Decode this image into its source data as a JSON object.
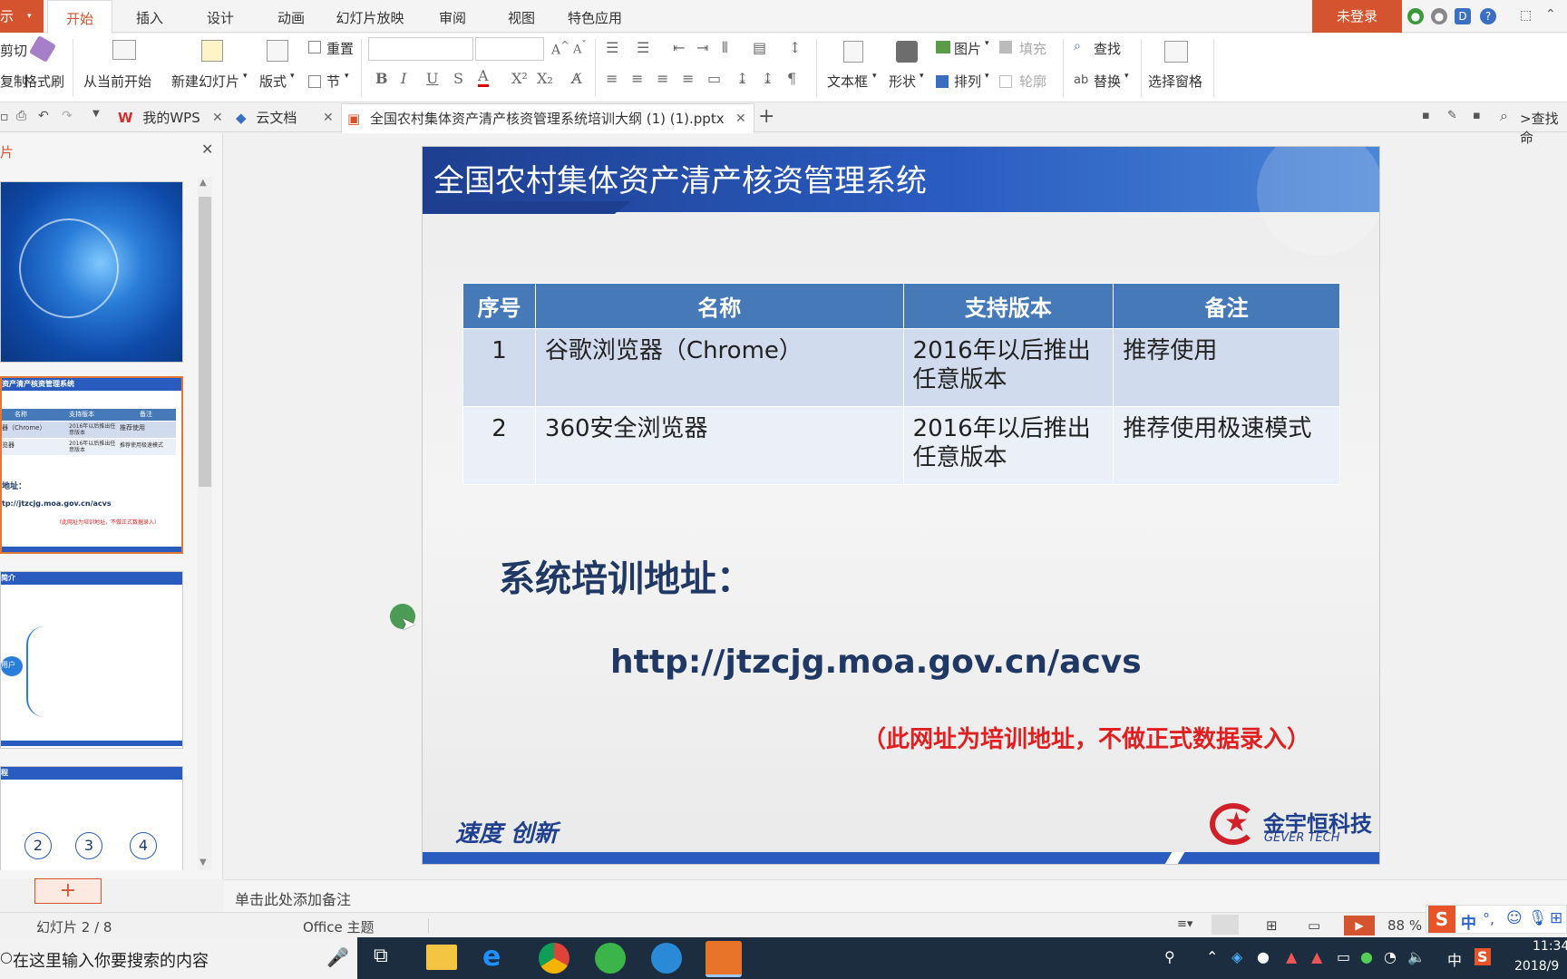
{
  "app": {
    "label": "示",
    "login": "未登录"
  },
  "menu": [
    "开始",
    "插入",
    "设计",
    "动画",
    "幻灯片放映",
    "审阅",
    "视图",
    "特色应用"
  ],
  "ribbon": {
    "cut": "剪切",
    "copy": "复制",
    "format_painter": "格式刷",
    "from_current": "从当前开始",
    "new_slide": "新建幻灯片",
    "layout": "版式",
    "reset": "重置",
    "section": "节",
    "textbox": "文本框",
    "shape": "形状",
    "picture": "图片",
    "fill": "填充",
    "arrange": "排列",
    "outline": "轮廓",
    "find": "查找",
    "replace": "替换",
    "select_pane": "选择窗格"
  },
  "doc_tabs": {
    "wps": "我的WPS",
    "cloud": "云文档",
    "file": "全国农村集体资产清产核资管理系统培训大纲 (1) (1).pptx",
    "find_cmd": ">查找命"
  },
  "left_panel": {
    "title": "片",
    "add": "+"
  },
  "slide": {
    "title": "全国农村集体资产清产核资管理系统",
    "table_headers": [
      "序号",
      "名称",
      "支持版本",
      "备注"
    ],
    "table_rows": [
      [
        "1",
        "谷歌浏览器（Chrome）",
        "2016年以后推出任意版本",
        "推荐使用"
      ],
      [
        "2",
        "360安全浏览器",
        "2016年以后推出任意版本",
        "推荐使用极速模式"
      ]
    ],
    "training_label": "系统培训地址：",
    "training_url": "http://jtzcjg.moa.gov.cn/acvs",
    "training_note": "（此网址为培训地址，不做正式数据录入）",
    "slogan": "速度  创新",
    "logo_text": "金宇恒科技",
    "logo_sub": "GEVER TECH"
  },
  "thumbs": {
    "t2_title": "资产清产核资管理系统",
    "t2_h1": "名称",
    "t2_h2": "支持版本",
    "t2_h3": "备注",
    "t2_r1": "器（Chrome）",
    "t2_r1b": "2016年以后推出任意版本",
    "t2_r1c": "推荐使用",
    "t2_r2": "览器",
    "t2_r2c": "推荐使用极速模式",
    "t2_addr": "地址：",
    "t2_url": "tp://jtzcjg.moa.gov.cn/acvs",
    "t2_note": "（此网址为培训地址，不做正式数据录入）",
    "t3_title": "简介",
    "t3_user": "用户",
    "t4_title": "程",
    "t4_n": [
      "2",
      "3",
      "4"
    ]
  },
  "notes_placeholder": "单击此处添加备注",
  "status": {
    "slide_counter": "幻灯片 2 / 8",
    "theme": "Office 主题",
    "zoom": "88 %"
  },
  "taskbar": {
    "search": "在这里输入你要搜索的内容",
    "time": "11:34",
    "date": "2018/9",
    "ime": "中"
  }
}
